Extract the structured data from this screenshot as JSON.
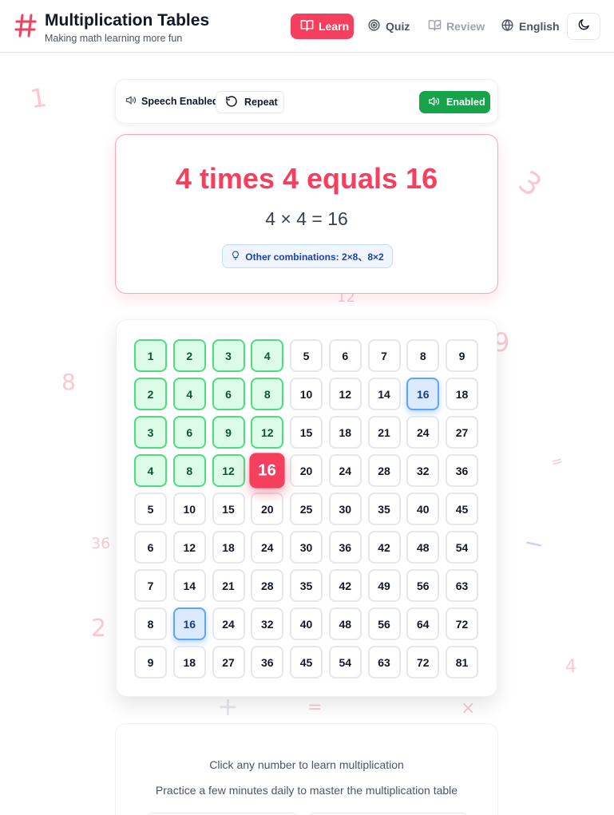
{
  "header": {
    "title": "Multiplication Tables",
    "subtitle": "Making math learning more fun",
    "nav": {
      "learn": "Learn",
      "quiz": "Quiz",
      "review": "Review",
      "language": "English"
    }
  },
  "speech": {
    "status_label": "Speech Enabled",
    "repeat_label": "Repeat",
    "enabled_label": "Enabled"
  },
  "equation": {
    "words": "4 times 4 equals 16",
    "math": "4 × 4 = 16",
    "combinations": "Other combinations: 2×8、8×2"
  },
  "grid": {
    "selected": [
      4,
      4
    ],
    "rows": [
      [
        1,
        2,
        3,
        4,
        5,
        6,
        7,
        8,
        9
      ],
      [
        2,
        4,
        6,
        8,
        10,
        12,
        14,
        16,
        18
      ],
      [
        3,
        6,
        9,
        12,
        15,
        18,
        21,
        24,
        27
      ],
      [
        4,
        8,
        12,
        16,
        20,
        24,
        28,
        32,
        36
      ],
      [
        5,
        10,
        15,
        20,
        25,
        30,
        35,
        40,
        45
      ],
      [
        6,
        12,
        18,
        24,
        30,
        36,
        42,
        48,
        54
      ],
      [
        7,
        14,
        21,
        28,
        35,
        42,
        49,
        56,
        63
      ],
      [
        8,
        16,
        24,
        32,
        40,
        48,
        56,
        64,
        72
      ],
      [
        9,
        18,
        27,
        36,
        45,
        54,
        63,
        72,
        81
      ]
    ],
    "alternate_cells": [
      [
        2,
        8
      ],
      [
        8,
        2
      ]
    ]
  },
  "tips": {
    "line1": "Click any number to learn multiplication",
    "line2": "Practice a few minutes daily to master the multiplication table"
  },
  "decorations": [
    "1",
    "3",
    "12",
    "9",
    "8",
    "36",
    "2",
    "4",
    "+",
    "=",
    "×",
    "=",
    "−"
  ],
  "colors": {
    "accent": "#f43f5e",
    "success": "#16a34a",
    "path_fill": "#dcfce7",
    "alt_fill": "#dbeafe"
  }
}
